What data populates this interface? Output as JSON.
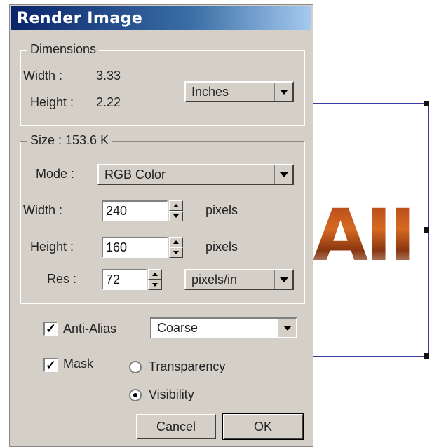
{
  "dialog": {
    "title": "Render Image"
  },
  "dimensions": {
    "group_label": "Dimensions",
    "width_label": "Width :",
    "width_value": "3.33",
    "height_label": "Height :",
    "height_value": "2.22",
    "units_selected": "Inches"
  },
  "size": {
    "group_label": "Size : 153.6 K",
    "mode_label": "Mode :",
    "mode_selected": "RGB Color",
    "width_label": "Width :",
    "width_value": "240",
    "width_unit": "pixels",
    "height_label": "Height :",
    "height_value": "160",
    "height_unit": "pixels",
    "res_label": "Res :",
    "res_value": "72",
    "res_units_selected": "pixels/in"
  },
  "options": {
    "antialias_label": "Anti-Alias",
    "antialias_checked": true,
    "antialias_selected": "Coarse",
    "mask_label": "Mask",
    "mask_checked": true,
    "radio_transparency": "Transparency",
    "radio_visibility": "Visibility",
    "radio_selected": "Visibility"
  },
  "buttons": {
    "cancel": "Cancel",
    "ok": "OK"
  },
  "canvas": {
    "art_text": "AII"
  },
  "colors": {
    "titlebar_start": "#0a246a",
    "dialog_bg": "#d4d0c8",
    "selection": "#3a3aa0"
  }
}
